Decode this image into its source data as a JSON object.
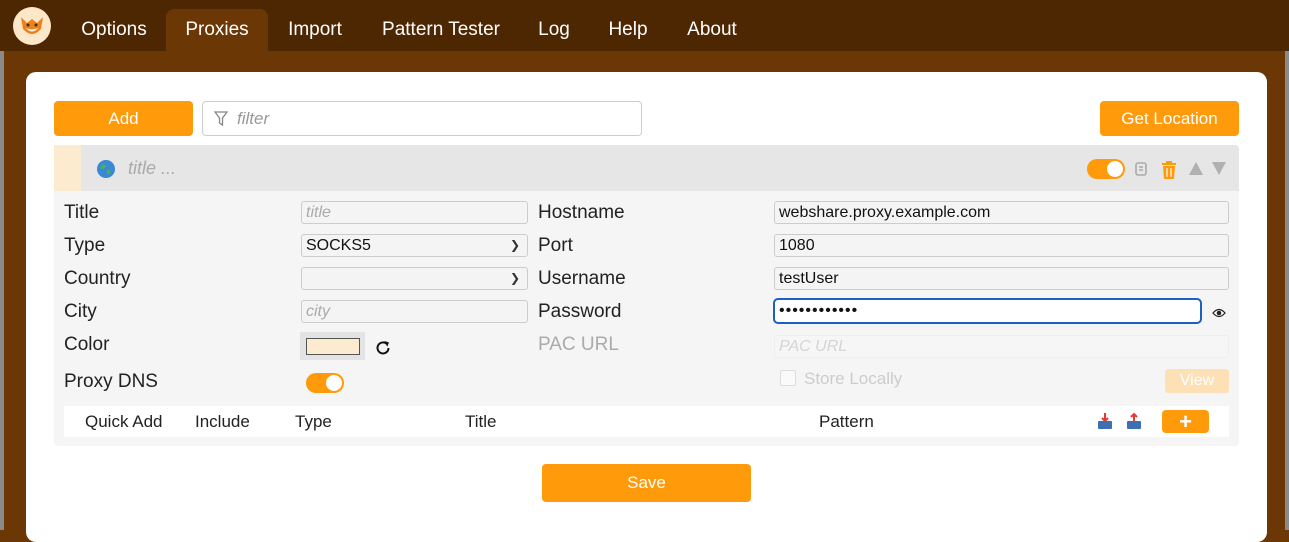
{
  "nav": {
    "tabs": [
      {
        "label": "Options"
      },
      {
        "label": "Proxies"
      },
      {
        "label": "Import"
      },
      {
        "label": "Pattern Tester"
      },
      {
        "label": "Log"
      },
      {
        "label": "Help"
      },
      {
        "label": "About"
      }
    ],
    "active_tab": "Proxies"
  },
  "toolbar": {
    "add_label": "Add",
    "filter_placeholder": "filter",
    "get_location_label": "Get Location"
  },
  "proxy": {
    "header_title_placeholder": "title ...",
    "enabled": true,
    "color": "#fdebd0",
    "labels": {
      "title": "Title",
      "type": "Type",
      "country": "Country",
      "city": "City",
      "color": "Color",
      "proxy_dns": "Proxy DNS",
      "hostname": "Hostname",
      "port": "Port",
      "username": "Username",
      "password": "Password",
      "pac_url": "PAC URL"
    },
    "title_placeholder": "title",
    "type_value": "SOCKS5",
    "country_value": "",
    "city_placeholder": "city",
    "proxy_dns": true,
    "hostname": "webshare.proxy.example.com",
    "port": "1080",
    "username": "testUser",
    "password": "••••••••••••",
    "pac_url_placeholder": "PAC URL",
    "store_locally_label": "Store Locally",
    "view_label": "View"
  },
  "patterns": {
    "columns": [
      "Quick Add",
      "Include",
      "Type",
      "Title",
      "Pattern"
    ],
    "add_label": "+"
  },
  "save_label": "Save",
  "colors": {
    "accent": "#ff9a0b",
    "topbar": "#4d2602",
    "background": "#6b3705"
  }
}
